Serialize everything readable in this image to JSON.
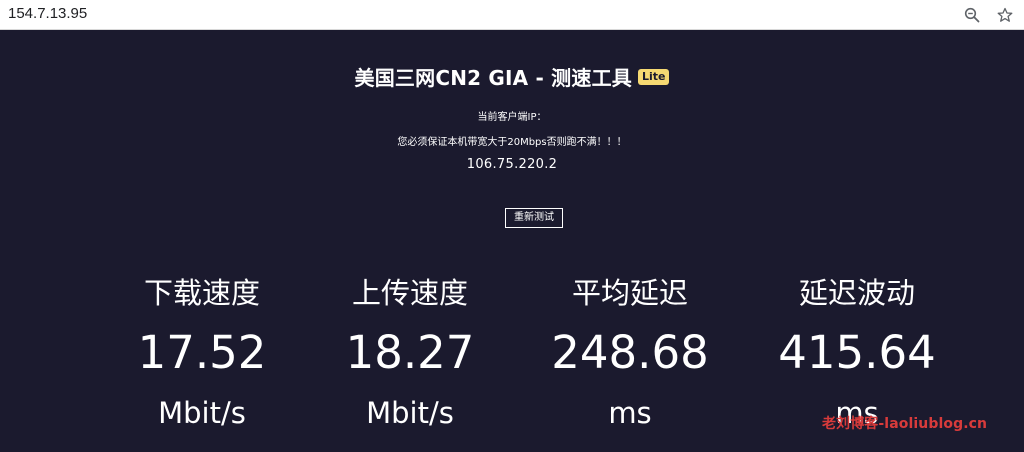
{
  "browser": {
    "url": "154.7.13.95",
    "icons": [
      "zoom-icon",
      "star-icon"
    ]
  },
  "header": {
    "title": "美国三网CN2 GIA - 测速工具",
    "badge": "Lite",
    "client_ip_label": "当前客户端IP：",
    "warning": "您必须保证本机带宽大于20Mbps否则跑不满！！！",
    "client_ip": "106.75.220.2",
    "retest_label": "重新测试"
  },
  "metrics": [
    {
      "label": "下载速度",
      "value": "17.52",
      "unit": "Mbit/s"
    },
    {
      "label": "上传速度",
      "value": "18.27",
      "unit": "Mbit/s"
    },
    {
      "label": "平均延迟",
      "value": "248.68",
      "unit": "ms"
    },
    {
      "label": "延迟波动",
      "value": "415.64",
      "unit": "ms"
    }
  ],
  "watermark": "老刘博客-laoliublog.cn",
  "colors": {
    "background": "#1b1a2e",
    "badge": "#f6d972",
    "watermark": "#d83b3b"
  }
}
